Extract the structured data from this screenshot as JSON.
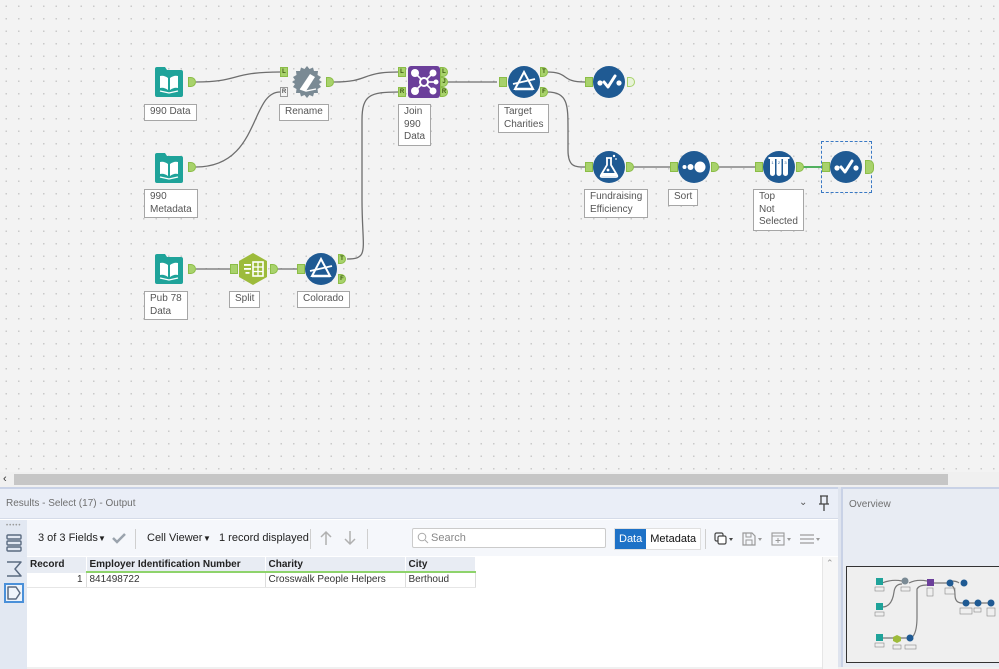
{
  "workflow": {
    "tools": [
      {
        "id": "t1",
        "type": "input",
        "label": "990 Data",
        "icon": "book-icon",
        "color": "#1fa39a"
      },
      {
        "id": "t2",
        "type": "input",
        "label": "990\nMetadata",
        "icon": "book-icon",
        "color": "#1fa39a"
      },
      {
        "id": "t3",
        "type": "input",
        "label": "Pub 78\nData",
        "icon": "book-icon",
        "color": "#1fa39a"
      },
      {
        "id": "t4",
        "type": "dynamic-rename",
        "label": "Rename",
        "icon": "rename-icon",
        "color": "#7a8a94"
      },
      {
        "id": "t5",
        "type": "text-to-columns",
        "label": "Split",
        "icon": "split-icon",
        "color": "#9dbb3b"
      },
      {
        "id": "t6",
        "type": "filter",
        "label": "Colorado",
        "icon": "filter-icon",
        "color": "#1f5a93"
      },
      {
        "id": "t7",
        "type": "join",
        "label": "Join\n990\nData",
        "icon": "join-icon",
        "color": "#6b3f9a"
      },
      {
        "id": "t8",
        "type": "filter",
        "label": "Target\nCharities",
        "icon": "filter-icon",
        "color": "#1f5a93"
      },
      {
        "id": "t9",
        "type": "select",
        "label": "",
        "icon": "select-check-icon",
        "color": "#1f5a93"
      },
      {
        "id": "t10",
        "type": "formula",
        "label": "Fundraising\nEfficiency",
        "icon": "flask-icon",
        "color": "#1f5a93"
      },
      {
        "id": "t11",
        "type": "sort",
        "label": "Sort",
        "icon": "sort-icon",
        "color": "#1f5a93"
      },
      {
        "id": "t12",
        "type": "sample",
        "label": "Top\nNot\nSelected",
        "icon": "test-tubes-icon",
        "color": "#1f5a93"
      },
      {
        "id": "t13",
        "type": "select",
        "label": "",
        "icon": "select-check-icon",
        "color": "#1f5a93",
        "selected": true
      }
    ],
    "anchor_labels": {
      "left": "L",
      "right": "R",
      "join": "J",
      "true": "T",
      "false": "F"
    }
  },
  "results": {
    "title": "Results - Select (17) - Output",
    "toolbar": {
      "fields_label": "3 of 3 Fields",
      "viewer_label": "Cell Viewer",
      "record_count": "1 record displayed",
      "search_placeholder": "Search",
      "data_tab": "Data",
      "metadata_tab": "Metadata"
    },
    "table": {
      "columns": [
        "Record",
        "Employer Identification Number",
        "Charity",
        "City"
      ],
      "rows": [
        [
          "1",
          "841498722",
          "Crosswalk People Helpers",
          "Berthoud"
        ]
      ]
    }
  },
  "overview": {
    "title": "Overview"
  },
  "colors": {
    "anchor_green": "#a8d26b",
    "accent_blue": "#1e72c7",
    "tool_blue": "#1f5a93",
    "input_teal": "#1fa39a",
    "join_purple": "#6b3f9a"
  }
}
